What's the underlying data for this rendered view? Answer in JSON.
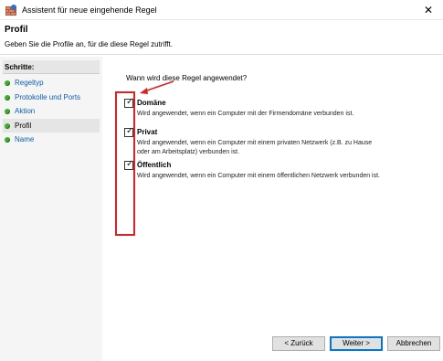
{
  "window": {
    "title": "Assistent für neue eingehende Regel",
    "close_glyph": "✕"
  },
  "header": {
    "title": "Profil",
    "subtitle": "Geben Sie die Profile an, für die diese Regel zutrifft."
  },
  "sidebar": {
    "heading": "Schritte:",
    "steps": [
      {
        "label": "Regeltyp",
        "current": false
      },
      {
        "label": "Protokolle und Ports",
        "current": false
      },
      {
        "label": "Aktion",
        "current": false
      },
      {
        "label": "Profil",
        "current": true
      },
      {
        "label": "Name",
        "current": false
      }
    ],
    "dot_color": "#3fae29",
    "link_color": "#0c5fb0"
  },
  "main": {
    "question": "Wann wird diese Regel angewendet?",
    "options": [
      {
        "label": "Domäne",
        "checked": true,
        "description": "Wird angewendet, wenn ein Computer mit der Firmendomäne verbunden ist."
      },
      {
        "label": "Privat",
        "checked": true,
        "description": "Wird angewendet, wenn ein Computer mit einem privaten Netzwerk (z.B. zu Hause oder am Arbeitsplatz) verbunden ist."
      },
      {
        "label": "Öffentlich",
        "checked": true,
        "description": "Wird angewendet, wenn ein Computer mit einem öffentlichen Netzwerk verbunden ist."
      }
    ],
    "highlight_color": "#e02020"
  },
  "buttons": {
    "back": "< Zurück",
    "next": "Weiter >",
    "cancel": "Abbrechen"
  }
}
